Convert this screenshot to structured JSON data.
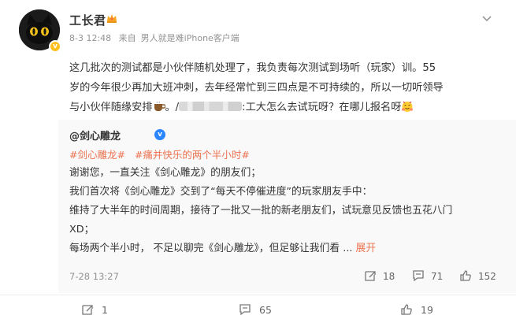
{
  "post": {
    "author": "工长君",
    "time": "8-3 12:48",
    "source_prefix": "来自",
    "source": "男人就是难iPhone客户端",
    "line1": "这几批次的测试都是小伙伴随机处理了，我负责每次测试到场听（玩家）训。55",
    "line2": "岁的今年很少再加大班冲刺，去年经常忙到三四点是不可持续的，所以一切听领导",
    "line3a": "与小伙伴随缘安排",
    "line3b": "。/",
    "line3c": ":工大怎么去试玩呀？在哪儿报名呀",
    "icons": {
      "avatar": "black-cat-avatar",
      "verified": "yellow-v-icon",
      "crown": "crown-icon",
      "menu": "chevron-down-icon"
    }
  },
  "repost": {
    "author": "@剑心雕龙",
    "tags": [
      "#剑心雕龙#",
      "#痛并快乐的两个半小时#"
    ],
    "lines": [
      "谢谢您，一直关注《剑心雕龙》的朋友们；",
      "我们首次将《剑心雕龙》交到了“每天不停催进度”的玩家朋友手中：",
      "维持了大半年的时间周期，接待了一批又一批的新老朋友们，试玩意见反馈也五花八门",
      "XD；",
      "每场两个半小时， 不足以聊完《剑心雕龙》，但足够让我们看"
    ],
    "ellipsis": " ... ",
    "expand": "展开",
    "time": "7-28 13:27",
    "reposts": "18",
    "comments": "71",
    "likes": "152"
  },
  "actions": {
    "reposts": "1",
    "comments": "65",
    "likes": "19"
  },
  "colors": {
    "link": "#eb7350",
    "muted": "#939393",
    "verified_blue": "#2a86ff",
    "verified_yellow": "#ffc01e"
  }
}
